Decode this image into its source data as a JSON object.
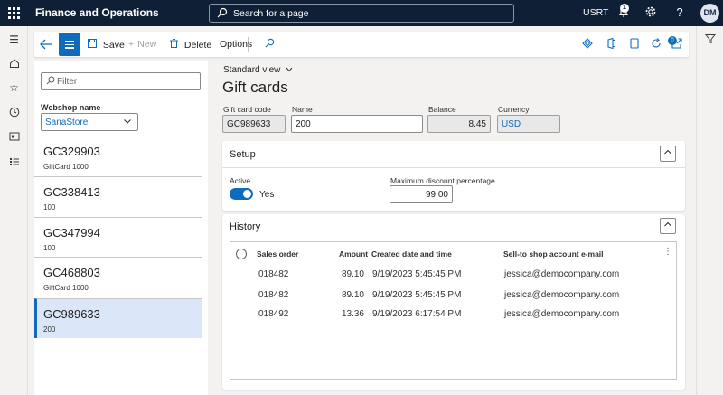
{
  "topbar": {
    "app_title": "Finance and Operations",
    "search_placeholder": "Search for a page",
    "company": "USRT",
    "notification_count": "1",
    "avatar_initials": "DM"
  },
  "actionpane": {
    "save": "Save",
    "new": "New",
    "delete": "Delete",
    "options": "Options",
    "attach_count": "0"
  },
  "list": {
    "filter_placeholder": "Filter",
    "webshop_label": "Webshop name",
    "webshop_value": "SanaStore",
    "items": [
      {
        "code": "GC329903",
        "sub": "GiftCard 1000"
      },
      {
        "code": "GC338413",
        "sub": "100"
      },
      {
        "code": "GC347994",
        "sub": "100"
      },
      {
        "code": "GC468803",
        "sub": "GiftCard 1000"
      },
      {
        "code": "GC989633",
        "sub": "200"
      }
    ]
  },
  "content": {
    "view_name": "Standard view",
    "page_title": "Gift cards",
    "header_fields": {
      "code_label": "Gift card code",
      "code_value": "GC989633",
      "name_label": "Name",
      "name_value": "200",
      "balance_label": "Balance",
      "balance_value": "8.45",
      "currency_label": "Currency",
      "currency_value": "USD"
    },
    "setup": {
      "title": "Setup",
      "active_label": "Active",
      "active_value": "Yes",
      "max_discount_label": "Maximum discount percentage",
      "max_discount_value": "99.00"
    },
    "history": {
      "title": "History",
      "columns": [
        "Sales order",
        "Amount",
        "Created date and time",
        "Sell-to shop account e-mail"
      ],
      "rows": [
        {
          "order": "018482",
          "amount": "89.10",
          "created": "9/19/2023 5:45:45 PM",
          "email": "jessica@democompany.com"
        },
        {
          "order": "018482",
          "amount": "89.10",
          "created": "9/19/2023 5:45:45 PM",
          "email": "jessica@democompany.com"
        },
        {
          "order": "018492",
          "amount": "13.36",
          "created": "9/19/2023 6:17:54 PM",
          "email": "jessica@democompany.com"
        }
      ]
    }
  }
}
